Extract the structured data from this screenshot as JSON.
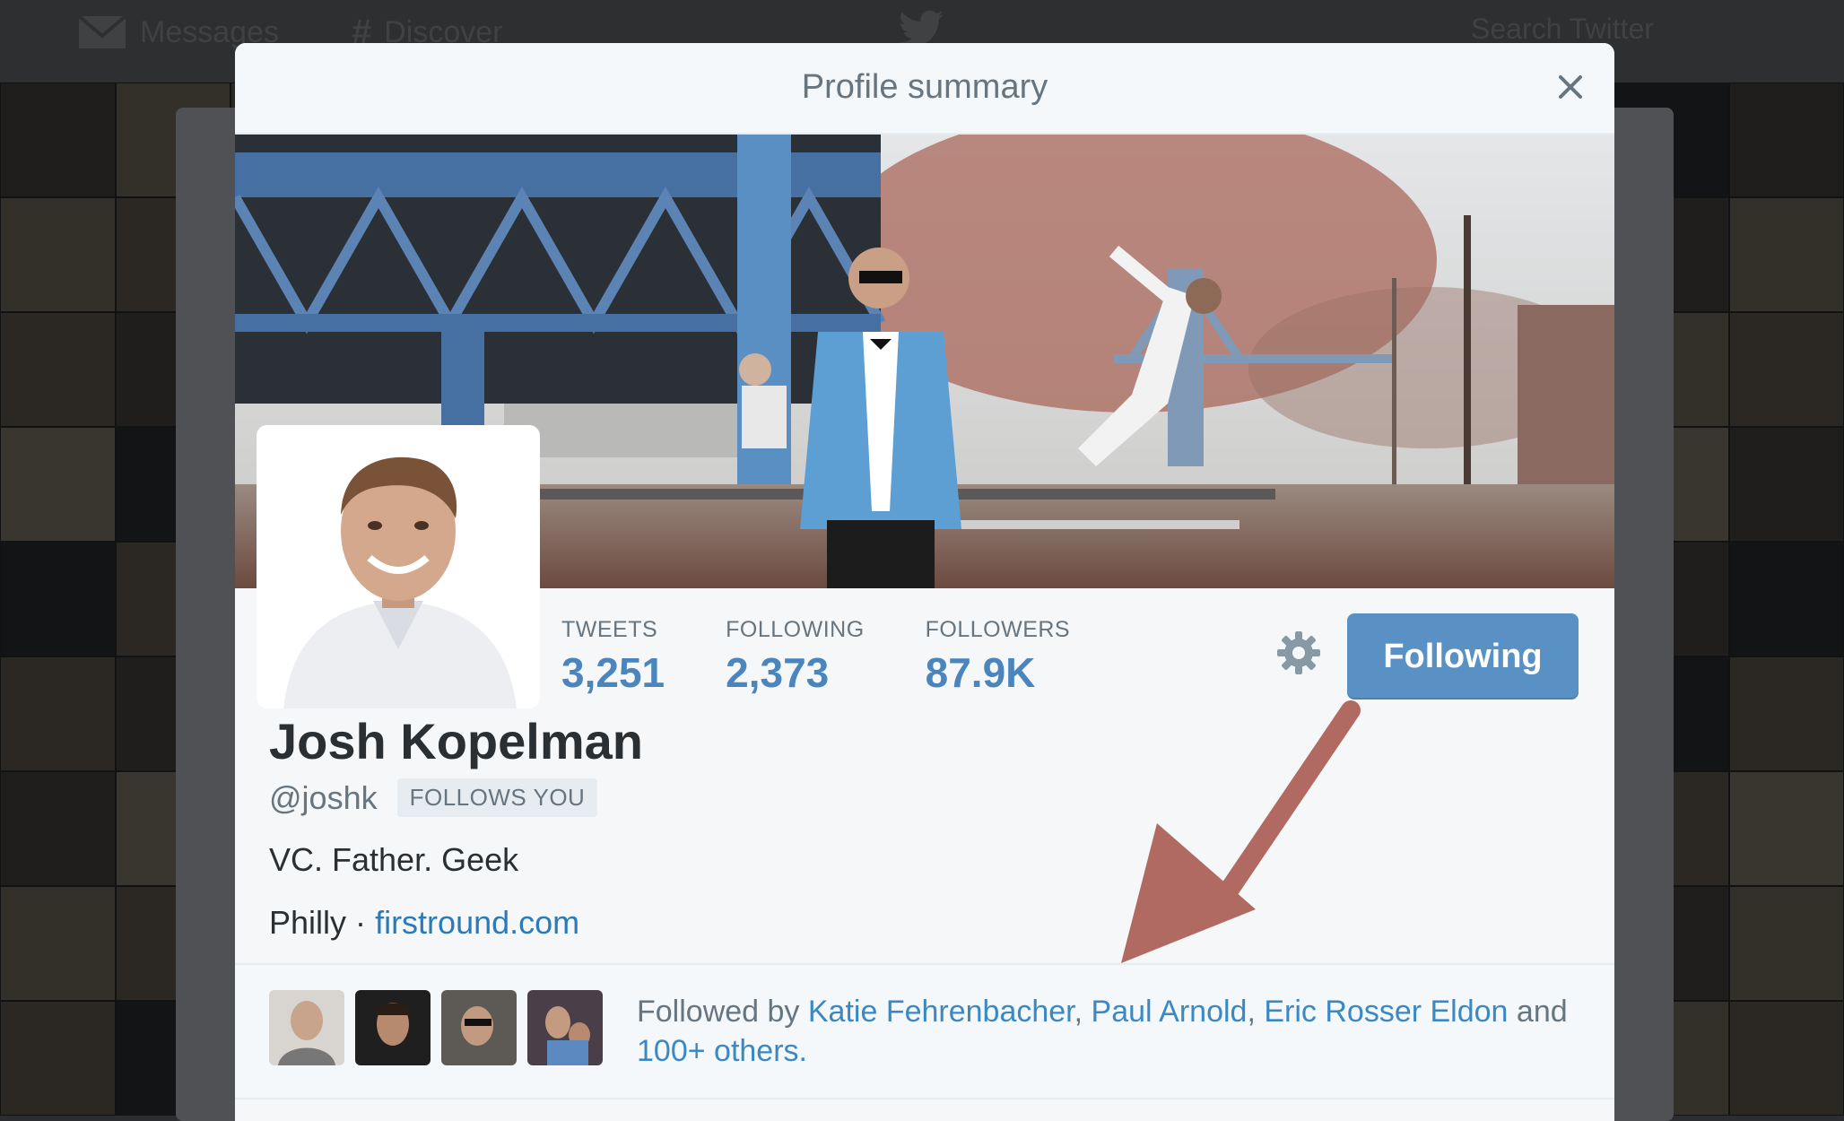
{
  "topnav": {
    "messages_label": "Messages",
    "discover_label": "Discover",
    "search_placeholder": "Search Twitter"
  },
  "modal": {
    "title": "Profile summary"
  },
  "profile": {
    "name": "Josh Kopelman",
    "handle": "@joshk",
    "follows_you_badge": "FOLLOWS YOU",
    "bio": "VC. Father. Geek",
    "location": "Philly",
    "separator": "·",
    "website": "firstround.com",
    "stats": [
      {
        "label": "TWEETS",
        "value": "3,251"
      },
      {
        "label": "FOLLOWING",
        "value": "2,373"
      },
      {
        "label": "FOLLOWERS",
        "value": "87.9K"
      }
    ],
    "follow_button_label": "Following"
  },
  "followed_by": {
    "prefix": "Followed by",
    "names": [
      "Katie Fehrenbacher",
      "Paul Arnold",
      "Eric Rosser Eldon"
    ],
    "comma": ",",
    "and": "and",
    "others": "100+ others."
  },
  "colors": {
    "accent_blue": "#5a91c5",
    "link_blue": "#2b7bb9",
    "annotation_arrow": "#b06a62"
  }
}
